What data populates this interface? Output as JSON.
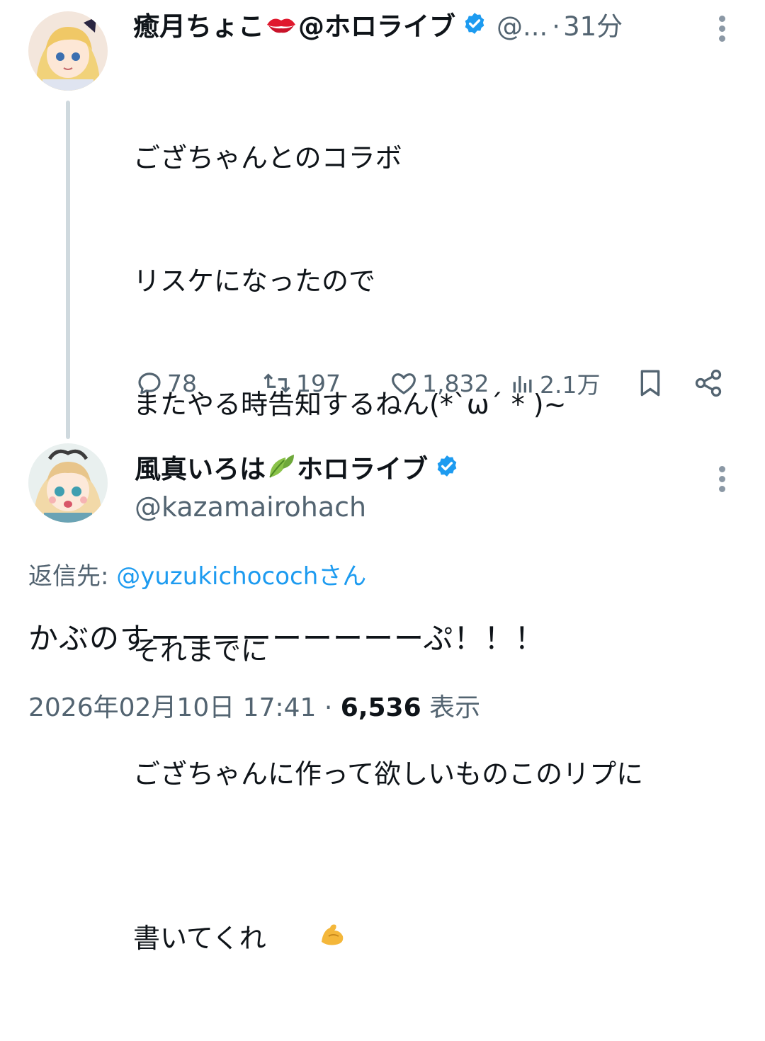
{
  "tweet": {
    "author_name": "癒月ちょこ",
    "author_suffix": "@ホロライブ",
    "author_name_emoji": "kiss-mark-emoji",
    "handle": "@...",
    "separator": "·",
    "time_ago": "31分",
    "text_lines": [
      "ござちゃんとのコラボ",
      "リスケになったので",
      "またやる時告知するねん(*`ω´ * )~",
      "",
      "それまでに",
      "ござちゃんに作って欲しいものこのリプに",
      "書いてくれ"
    ],
    "text_end_emoji": "flexed-biceps-emoji",
    "actions": {
      "replies": "78",
      "retweets": "197",
      "likes": "1,832",
      "views": "2.1万"
    }
  },
  "reply": {
    "author_name": "風真いろは",
    "author_suffix": "ホロライブ",
    "author_name_emoji": "leaf-emoji",
    "handle": "@kazamairohach",
    "reply_to_label": "返信先: ",
    "reply_to_user": "@yuzukichococh",
    "reply_to_suffix": "さん",
    "text": "かぶのすーーーーーーーーーぷ！！！",
    "date": "2026年02月10日 17:41",
    "dot": " · ",
    "view_count": "6,536",
    "view_label": " 表示"
  },
  "colors": {
    "verified": "#1d9bf0",
    "link": "#1d9bf0",
    "secondary_text": "#536471",
    "thread_line": "#cfd9de"
  }
}
